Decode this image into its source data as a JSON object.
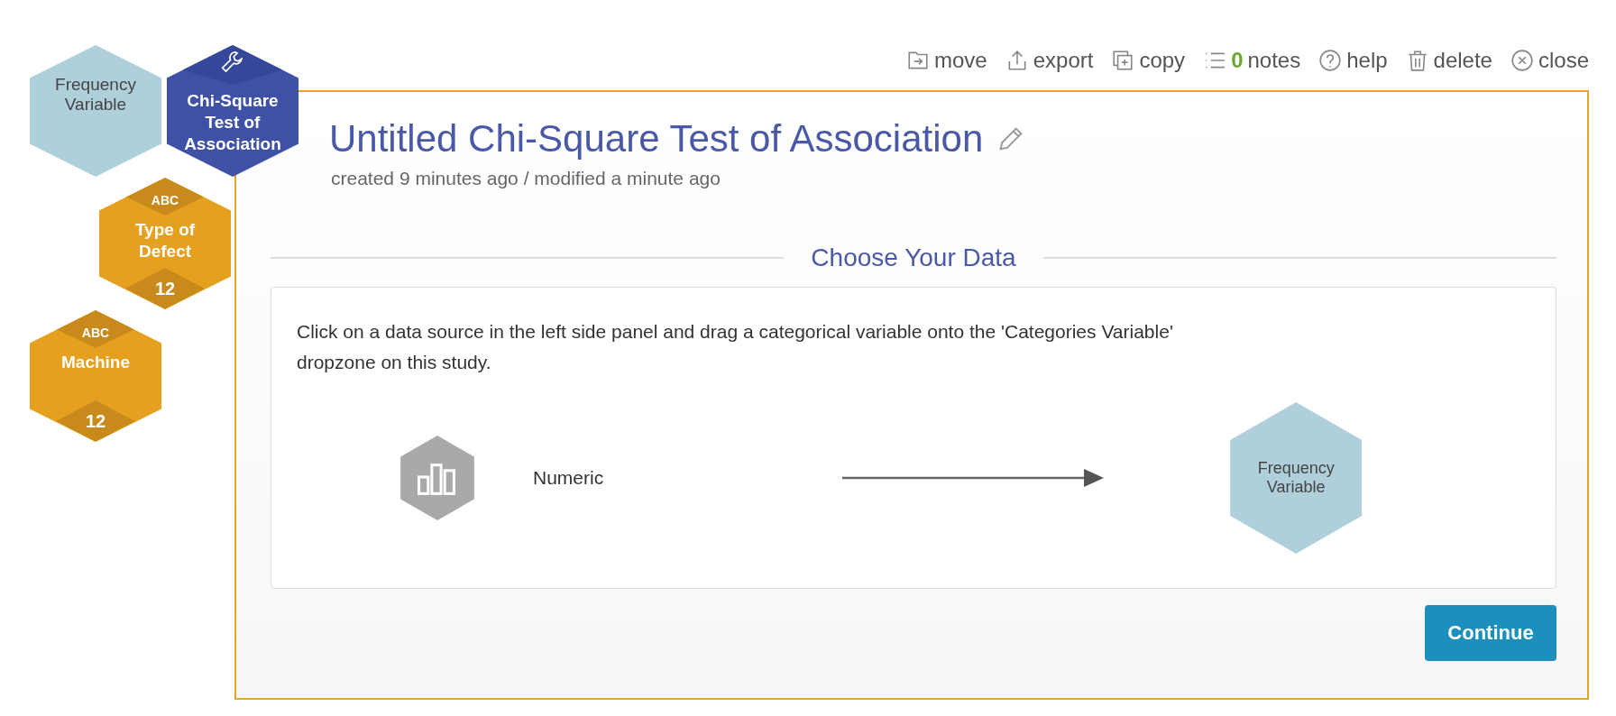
{
  "toolbar": [
    {
      "kind": "move",
      "label": "move"
    },
    {
      "kind": "export",
      "label": "export"
    },
    {
      "kind": "copy",
      "label": "copy"
    },
    {
      "kind": "notes",
      "count": "0",
      "label": "notes"
    },
    {
      "kind": "help",
      "label": "help"
    },
    {
      "kind": "delete",
      "label": "delete"
    },
    {
      "kind": "close",
      "label": "close"
    }
  ],
  "nodes": [
    {
      "kind": "slot",
      "label": "Frequency Variable"
    },
    {
      "kind": "tool",
      "label": "Chi-Square Test of Association"
    },
    {
      "kind": "categorical",
      "type_label": "ABC",
      "label": "Type of Defect",
      "count": "12"
    },
    {
      "kind": "categorical",
      "type_label": "ABC",
      "label": "Machine",
      "count": "12"
    }
  ],
  "study": {
    "title": "Untitled Chi-Square Test of Association",
    "meta": "created 9 minutes ago / modified a minute ago",
    "section": "Choose Your Data",
    "instruction": "Click on a data source in the left side panel and drag a categorical variable onto the 'Categories Variable' dropzone on this study.",
    "source": {
      "label": "Numeric"
    },
    "target": {
      "label": "Frequency Variable"
    },
    "button": "Continue"
  }
}
